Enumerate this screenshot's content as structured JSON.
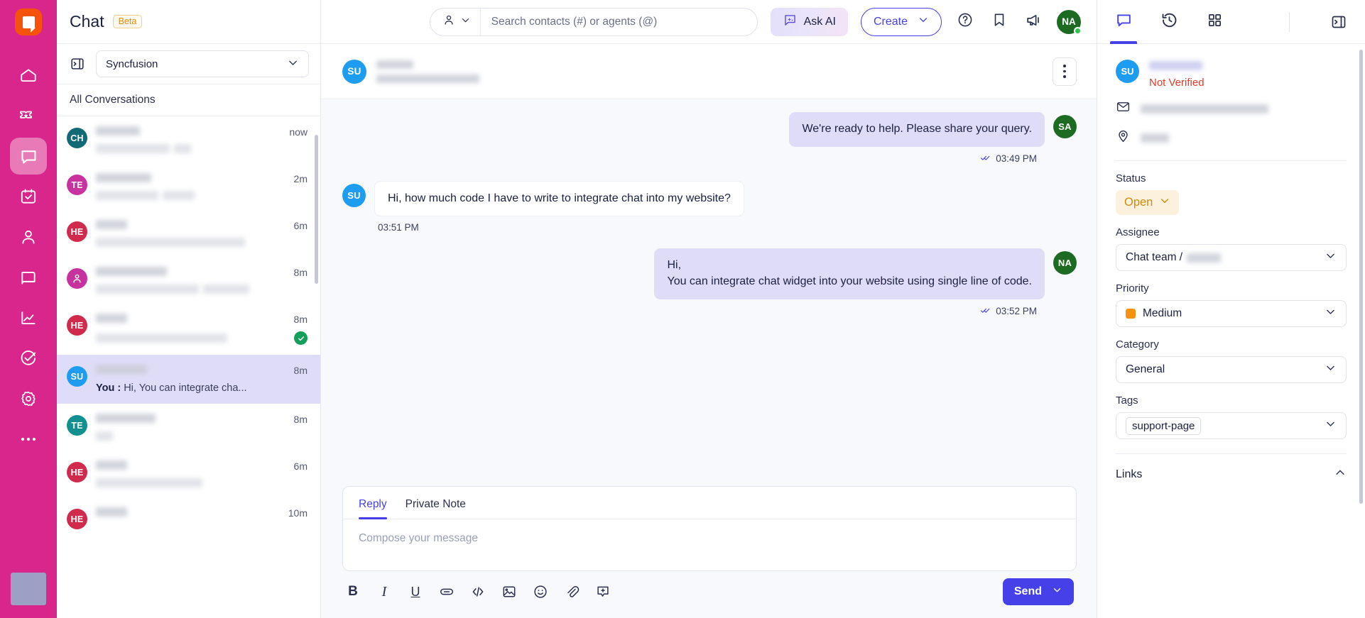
{
  "brand": {
    "logo_name": "app-logo",
    "rail_color": "#d9268c",
    "accent": "#4540e8"
  },
  "rail": {
    "items": [
      {
        "name": "home",
        "icon": "home-icon"
      },
      {
        "name": "tickets",
        "icon": "ticket-icon"
      },
      {
        "name": "chat",
        "icon": "chat-bubble-icon",
        "active": true
      },
      {
        "name": "tasks",
        "icon": "calendar-check-icon"
      },
      {
        "name": "contacts",
        "icon": "user-icon"
      },
      {
        "name": "knowledge-base",
        "icon": "book-icon"
      },
      {
        "name": "reports",
        "icon": "line-chart-icon"
      },
      {
        "name": "automation",
        "icon": "check-circle-icon"
      },
      {
        "name": "settings",
        "icon": "gear-icon"
      },
      {
        "name": "more",
        "icon": "ellipsis-icon"
      }
    ]
  },
  "conversation_panel": {
    "title": "Chat",
    "badge": "Beta",
    "collapse_icon": "panel-collapse-icon",
    "filter_value": "Syncfusion",
    "subheader": "All Conversations",
    "items": [
      {
        "initials": "CH",
        "color": "#126a77",
        "time": "now",
        "name_w": 62,
        "preview_w": 104,
        "preview_w2": 24,
        "selected": false,
        "verified": false,
        "preview_text": ""
      },
      {
        "initials": "TE",
        "color": "#c8329e",
        "time": "2m",
        "name_w": 78,
        "preview_w": 88,
        "preview_w2": 45,
        "selected": false,
        "verified": false,
        "preview_text": ""
      },
      {
        "initials": "HE",
        "color": "#d02b4c",
        "time": "6m",
        "name_w": 44,
        "preview_w": 210,
        "preview_w2": 0,
        "selected": false,
        "verified": false,
        "preview_text": ""
      },
      {
        "initials": "",
        "color": "#c8329e",
        "time": "8m",
        "name_w": 100,
        "preview_w": 145,
        "preview_w2": 65,
        "selected": false,
        "verified": false,
        "icon": "person-avatar-icon",
        "preview_text": ""
      },
      {
        "initials": "HE",
        "color": "#d02b4c",
        "time": "8m",
        "name_w": 44,
        "preview_w": 185,
        "preview_w2": 0,
        "selected": false,
        "verified": true,
        "preview_text": ""
      },
      {
        "initials": "SU",
        "color": "#1e9cf0",
        "time": "8m",
        "name_w": 72,
        "preview_w": 0,
        "preview_w2": 0,
        "selected": true,
        "verified": false,
        "preview_sender": "You :",
        "preview_text": "Hi, You can integrate cha..."
      },
      {
        "initials": "TE",
        "color": "#12908f",
        "time": "8m",
        "name_w": 84,
        "preview_w": 24,
        "preview_w2": 0,
        "selected": false,
        "verified": false,
        "preview_text": ""
      },
      {
        "initials": "HE",
        "color": "#d02b4c",
        "time": "6m",
        "name_w": 44,
        "preview_w": 150,
        "preview_w2": 0,
        "selected": false,
        "verified": false,
        "preview_text": ""
      },
      {
        "initials": "HE",
        "color": "#d02b4c",
        "time": "10m",
        "name_w": 44,
        "preview_w": 0,
        "preview_w2": 0,
        "selected": false,
        "verified": false,
        "preview_text": ""
      }
    ]
  },
  "topbar": {
    "search_placeholder": "Search contacts (#) or agents (@)",
    "search_value": "",
    "person_icon": "person-icon",
    "ask_ai_label": "Ask AI",
    "ask_ai_icon": "ai-sparkle-icon",
    "create_label": "Create",
    "help_icon": "help-circle-icon",
    "bookmark_icon": "bookmark-icon",
    "announce_icon": "megaphone-icon",
    "user_initials": "NA"
  },
  "chat_header": {
    "avatar_initials": "SU",
    "avatar_color": "#1e9cf0",
    "menu_icon": "kebab-menu-icon"
  },
  "messages": [
    {
      "direction": "out",
      "text": "We're ready to help. Please share your query.",
      "time": "03:49 PM",
      "avatar_initials": "SA",
      "avatar_color": "#1d6b23",
      "status_icon": "double-check-icon"
    },
    {
      "direction": "in",
      "text": "Hi, how much code I have to write to integrate chat into my website?",
      "time": "03:51 PM",
      "avatar_initials": "SU",
      "avatar_color": "#1e9cf0",
      "status_icon": ""
    },
    {
      "direction": "out",
      "line1": "Hi,",
      "line2": "You can integrate chat widget into your website using single line of code.",
      "time": "03:52 PM",
      "avatar_initials": "NA",
      "avatar_color": "#1d6b23",
      "status_icon": "double-check-icon"
    }
  ],
  "composer": {
    "tabs": [
      {
        "label": "Reply",
        "active": true
      },
      {
        "label": "Private Note",
        "active": false
      }
    ],
    "placeholder": "Compose your message",
    "send_label": "Send",
    "tools": [
      {
        "name": "bold-icon",
        "glyph": "B"
      },
      {
        "name": "italic-icon",
        "glyph": "I"
      },
      {
        "name": "underline-icon",
        "glyph": "U"
      },
      {
        "name": "link-icon",
        "glyph": ""
      },
      {
        "name": "code-icon",
        "glyph": "</>"
      },
      {
        "name": "image-icon",
        "glyph": ""
      },
      {
        "name": "emoji-icon",
        "glyph": ""
      },
      {
        "name": "attachment-icon",
        "glyph": ""
      },
      {
        "name": "insert-canned-response-icon",
        "glyph": ""
      }
    ]
  },
  "right_panel": {
    "tabs": [
      {
        "name": "details-tab",
        "icon": "chat-bubble-icon",
        "active": true
      },
      {
        "name": "history-tab",
        "icon": "history-clock-icon",
        "active": false
      },
      {
        "name": "apps-tab",
        "icon": "grid-apps-icon",
        "active": false
      }
    ],
    "collapse_icon": "panel-collapse-right-icon",
    "contact": {
      "avatar_initials": "SU",
      "verification": "Not Verified",
      "email_icon": "envelope-icon",
      "location_icon": "map-pin-icon"
    },
    "status": {
      "label": "Status",
      "value": "Open"
    },
    "assignee": {
      "label": "Assignee",
      "value": "Chat team /"
    },
    "priority": {
      "label": "Priority",
      "value": "Medium",
      "color": "#f59310"
    },
    "category": {
      "label": "Category",
      "value": "General"
    },
    "tags": {
      "label": "Tags",
      "values": [
        "support-page"
      ]
    },
    "links": {
      "label": "Links",
      "expanded": true,
      "caret_icon": "chevron-up-icon"
    }
  }
}
